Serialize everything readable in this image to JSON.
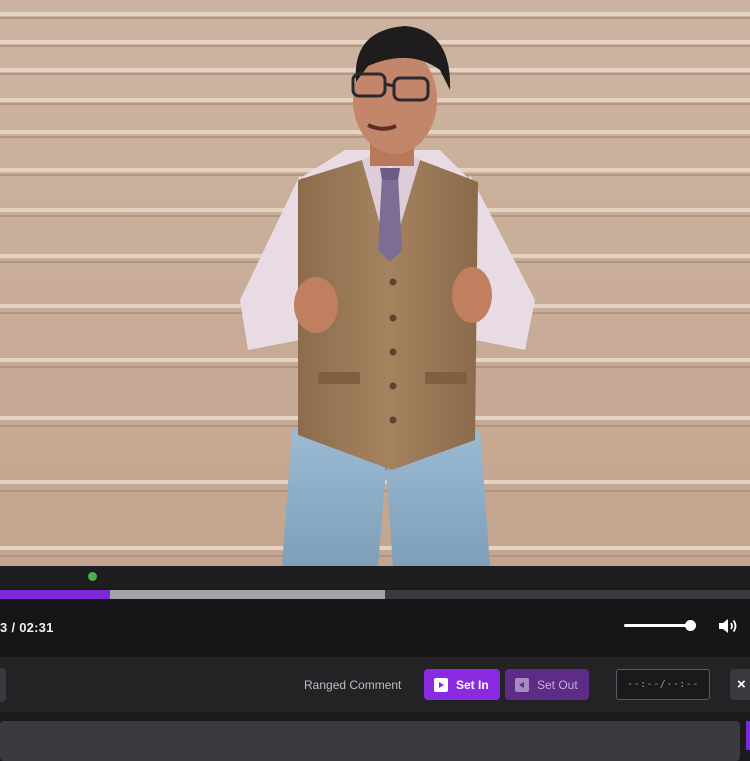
{
  "player": {
    "time_current_visible": "3",
    "time_separator": "/",
    "time_total": "02:31",
    "progress_played": 0.147,
    "progress_buffered": 0.513,
    "volume_level": 0.92
  },
  "comment_toolbar": {
    "ranged_label": "Ranged Comment",
    "set_in_label": "Set In",
    "set_out_label": "Set Out",
    "range_value": "--:--/--:--",
    "close_label": "×"
  },
  "icons": {
    "volume": "speaker-icon",
    "set_in": "set-in-icon",
    "set_out": "set-out-icon",
    "close": "close-icon",
    "marker": "comment-marker-icon"
  },
  "colors": {
    "accent": "#8a2be2",
    "accent_dim": "#5c2c86",
    "marker": "#4caf50"
  }
}
